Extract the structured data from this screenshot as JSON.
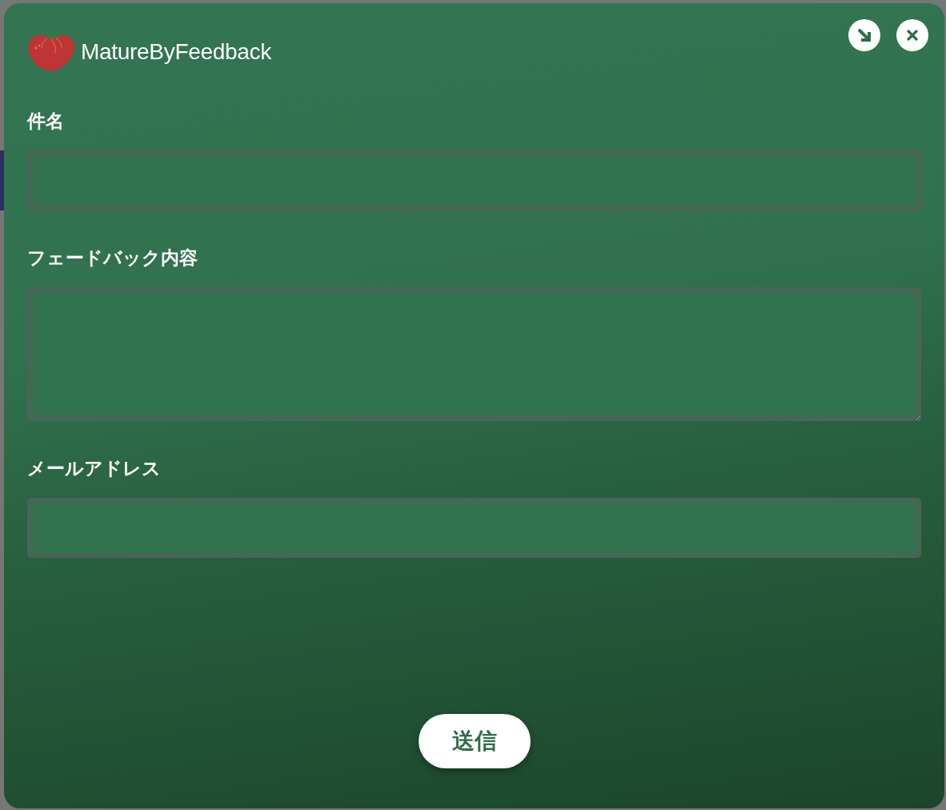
{
  "app": {
    "title": "MatureByFeedback"
  },
  "window_buttons": [
    {
      "kind": "minimize"
    },
    {
      "kind": "close"
    }
  ],
  "fields": [
    {
      "label": "件名",
      "kind": "input"
    },
    {
      "label": "フェードバック内容",
      "kind": "textarea"
    },
    {
      "label": "メールアドレス",
      "kind": "input"
    }
  ],
  "submit_button": {
    "label": "送信"
  }
}
